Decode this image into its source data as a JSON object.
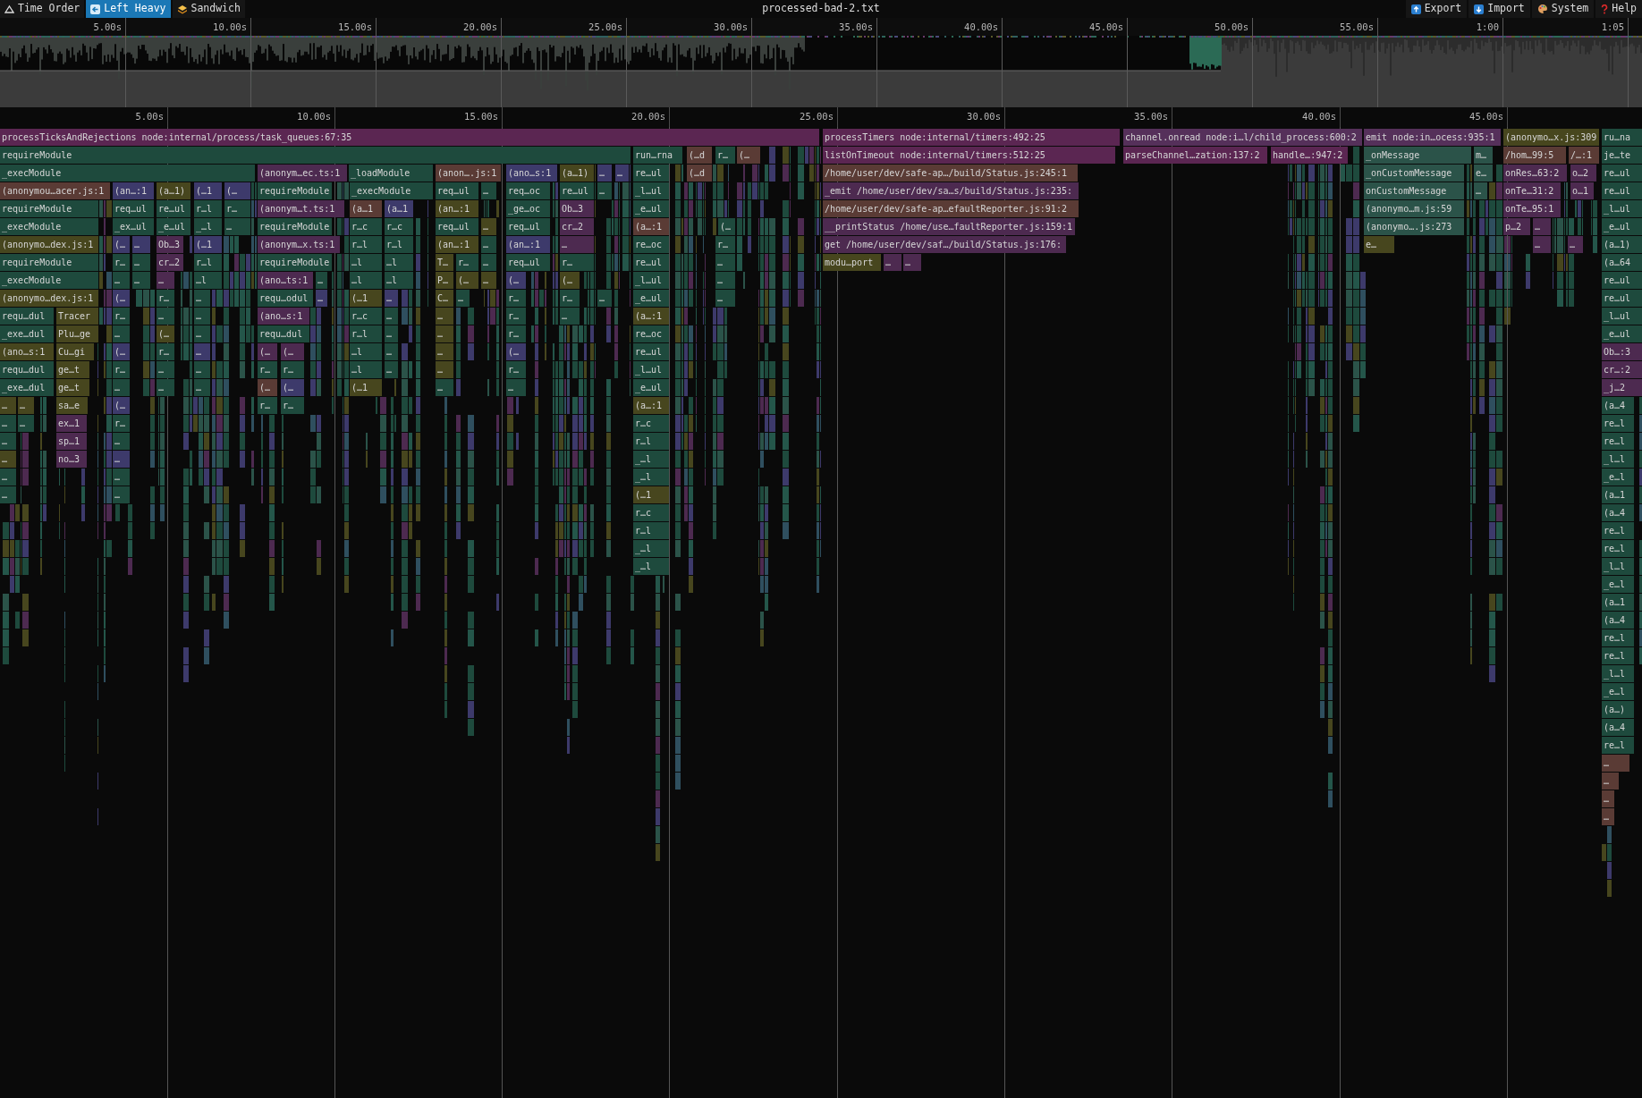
{
  "toolbar": {
    "view_tabs": [
      {
        "label": "Time Order",
        "selected": false,
        "kind": "time"
      },
      {
        "label": "Left Heavy",
        "selected": true,
        "kind": "left"
      },
      {
        "label": "Sandwich",
        "selected": false,
        "kind": "sandwich"
      }
    ],
    "title": "processed-bad-2.txt",
    "actions": [
      {
        "label": "Export",
        "kind": "export"
      },
      {
        "label": "Import",
        "kind": "import"
      },
      {
        "label": "System",
        "kind": "system"
      },
      {
        "label": "Help",
        "kind": "help"
      }
    ]
  },
  "overview": {
    "ticks": [
      "5.00s",
      "10.00s",
      "15.00s",
      "20.00s",
      "25.00s",
      "30.00s",
      "35.00s",
      "40.00s",
      "45.00s",
      "50.00s",
      "55.00s",
      "1:00",
      "1:05"
    ]
  },
  "ruler": {
    "ticks": [
      "5.00s",
      "10.00s",
      "15.00s",
      "20.00s",
      "25.00s",
      "30.00s",
      "35.00s",
      "40.00s",
      "45.00s"
    ]
  },
  "flame_rows": [
    [
      {
        "label": "processTicksAndRejections node:internal/process/task_queues:67:35",
        "color": "#5b2652"
      },
      {
        "label": "processTimers node:internal/timers:492:25",
        "color": "#5b2652"
      },
      {
        "label": "channel.onread node:i…l/child_process:600:2",
        "color": "#55305a"
      },
      {
        "label": "emit node:in…ocess:935:1",
        "color": "#55305a"
      },
      {
        "label": "(anonymo…x.js:309",
        "color": "#47461e"
      },
      {
        "label": "ru…na",
        "color": "#1e4a3d"
      }
    ],
    [
      {
        "label": "requireModule",
        "color": "#1e4a3d"
      },
      {
        "label": "run…rna",
        "color": "#1e4a3d"
      },
      {
        "label": "(…d",
        "color": "#5a3b35"
      },
      {
        "label": "r…",
        "color": "#1e4a3d"
      },
      {
        "label": "(…",
        "color": "#5a3b35"
      },
      {
        "label": "listOnTimeout node:internal/timers:512:25",
        "color": "#5b2652"
      },
      {
        "label": "parseChannel…zation:137:2",
        "color": "#5b2652"
      },
      {
        "label": "handle…:947:2",
        "color": "#5b2652"
      },
      {
        "label": "_onMessage",
        "color": "#2b5349"
      },
      {
        "label": "m…",
        "color": "#2b5349"
      },
      {
        "label": "/hom…99:5",
        "color": "#5a3b35"
      },
      {
        "label": "/…:1",
        "color": "#5a3b35"
      },
      {
        "label": "je…te",
        "color": "#1e4a3d"
      }
    ],
    [
      {
        "label": "_execModule",
        "color": "#1e4a3d"
      },
      {
        "label": "(anonym…ec.ts:1",
        "color": "#4d2a50"
      },
      {
        "label": "_loadModule",
        "color": "#1e4a3d"
      },
      {
        "label": "(anon….js:1",
        "color": "#5a3b35"
      },
      {
        "label": "(ano…s:1",
        "color": "#3d3a6b"
      },
      {
        "label": "(a…1)",
        "color": "#47461e"
      },
      {
        "label": "…",
        "color": "#3d3a6b"
      },
      {
        "label": "…",
        "color": "#3d3a6b"
      },
      {
        "label": "re…ul",
        "color": "#1e4a3d"
      },
      {
        "label": "(…d",
        "color": "#5a3b35"
      },
      {
        "label": "/home/user/dev/safe-ap…/build/Status.js:245:1",
        "color": "#5a3b35"
      },
      {
        "label": "_onCustomMessage",
        "color": "#2b5349"
      },
      {
        "label": "e…",
        "color": "#2b5349"
      },
      {
        "label": "onRes…63:2",
        "color": "#4d2a50"
      },
      {
        "label": "o…2",
        "color": "#4d2a50"
      },
      {
        "label": "re…ul",
        "color": "#1e4a3d"
      }
    ],
    [
      {
        "label": "(anonymou…acer.js:1",
        "color": "#5a3b35"
      },
      {
        "label": "(an…:1",
        "color": "#3d3a6b"
      },
      {
        "label": "(a…1)",
        "color": "#47461e"
      },
      {
        "label": "(…1",
        "color": "#3d3a6b"
      },
      {
        "label": "(…",
        "color": "#3d3a6b"
      },
      {
        "label": "requireModule",
        "color": "#1e4a3d"
      },
      {
        "label": "_execModule",
        "color": "#1e4a3d"
      },
      {
        "label": "req…ul",
        "color": "#1e4a3d"
      },
      {
        "label": "…",
        "color": "#1e4a3d"
      },
      {
        "label": "req…oc",
        "color": "#1e4a3d"
      },
      {
        "label": "re…ul",
        "color": "#1e4a3d"
      },
      {
        "label": "…",
        "color": "#1e4a3d"
      },
      {
        "label": "_l…ul",
        "color": "#1e4a3d"
      },
      {
        "label": "_emit /home/user/dev/sa…s/build/Status.js:235:",
        "color": "#4d2a50"
      },
      {
        "label": "onCustomMessage",
        "color": "#2b5349"
      },
      {
        "label": "…",
        "color": "#2b5349"
      },
      {
        "label": "onTe…31:2",
        "color": "#4d2a50"
      },
      {
        "label": "o…1",
        "color": "#4d2a50"
      },
      {
        "label": "re…ul",
        "color": "#1e4a3d"
      }
    ],
    [
      {
        "label": "requireModule",
        "color": "#1e4a3d"
      },
      {
        "label": "req…ul",
        "color": "#1e4a3d"
      },
      {
        "label": "re…ul",
        "color": "#1e4a3d"
      },
      {
        "label": "r…l",
        "color": "#1e4a3d"
      },
      {
        "label": "r…",
        "color": "#1e4a3d"
      },
      {
        "label": "(anonym…t.ts:1",
        "color": "#4d2a50"
      },
      {
        "label": "(a…1",
        "color": "#5a3b35"
      },
      {
        "label": "(a…1",
        "color": "#3d3a6b"
      },
      {
        "label": "(an…:1",
        "color": "#47461e"
      },
      {
        "label": "_ge…oc",
        "color": "#1e4a3d"
      },
      {
        "label": "Ob…3",
        "color": "#4d2a50"
      },
      {
        "label": "_e…ul",
        "color": "#1e4a3d"
      },
      {
        "label": "/home/user/dev/safe-ap…efaultReporter.js:91:2",
        "color": "#5a3b35"
      },
      {
        "label": "(anonymo…m.js:59",
        "color": "#2b5349"
      },
      {
        "label": "onTe…95:1",
        "color": "#4d2a50"
      },
      {
        "label": "_l…ul",
        "color": "#1e4a3d"
      }
    ],
    [
      {
        "label": "_execModule",
        "color": "#1e4a3d"
      },
      {
        "label": "_ex…ul",
        "color": "#1e4a3d"
      },
      {
        "label": "_e…ul",
        "color": "#1e4a3d"
      },
      {
        "label": "_…l",
        "color": "#1e4a3d"
      },
      {
        "label": "…",
        "color": "#1e4a3d"
      },
      {
        "label": "requireModule",
        "color": "#1e4a3d"
      },
      {
        "label": "r…c",
        "color": "#1e4a3d"
      },
      {
        "label": "r…c",
        "color": "#1e4a3d"
      },
      {
        "label": "req…ul",
        "color": "#1e4a3d"
      },
      {
        "label": "…",
        "color": "#47461e"
      },
      {
        "label": "req…ul",
        "color": "#1e4a3d"
      },
      {
        "label": "cr…2",
        "color": "#4d2a50"
      },
      {
        "label": "(a…:1",
        "color": "#5a3b35"
      },
      {
        "label": "(…",
        "color": "#1e4a3d"
      },
      {
        "label": "__printStatus /home/use…faultReporter.js:159:1",
        "color": "#4d2a50"
      },
      {
        "label": "(anonymo….js:273",
        "color": "#2b5349"
      },
      {
        "label": "p…2",
        "color": "#4d2a50"
      },
      {
        "label": "…",
        "color": "#4d2a50"
      },
      {
        "label": "_e…ul",
        "color": "#1e4a3d"
      }
    ],
    [
      {
        "label": "(anonymo…dex.js:1",
        "color": "#47461e"
      },
      {
        "label": "(…",
        "color": "#3d3a6b"
      },
      {
        "label": "…",
        "color": "#3d3a6b"
      },
      {
        "label": "Ob…3",
        "color": "#4d2a50"
      },
      {
        "label": "(…1",
        "color": "#3d3a6b"
      },
      {
        "label": "(anonym…x.ts:1",
        "color": "#4d2a50"
      },
      {
        "label": "r…l",
        "color": "#1e4a3d"
      },
      {
        "label": "r…l",
        "color": "#1e4a3d"
      },
      {
        "label": "(an…:1",
        "color": "#47461e"
      },
      {
        "label": "…",
        "color": "#1e4a3d"
      },
      {
        "label": "(an…:1",
        "color": "#3d3a6b"
      },
      {
        "label": "…",
        "color": "#4d2a50"
      },
      {
        "label": "re…oc",
        "color": "#1e4a3d"
      },
      {
        "label": "r…",
        "color": "#1e4a3d"
      },
      {
        "label": "get /home/user/dev/saf…/build/Status.js:176:",
        "color": "#4d2a50"
      },
      {
        "label": "e…",
        "color": "#47461e"
      },
      {
        "label": "…",
        "color": "#4d2a50"
      },
      {
        "label": "…",
        "color": "#4d2a50"
      },
      {
        "label": "(a…1)",
        "color": "#1e4a3d"
      }
    ],
    [
      {
        "label": "requireModule",
        "color": "#1e4a3d"
      },
      {
        "label": "r…",
        "color": "#1e4a3d"
      },
      {
        "label": "…",
        "color": "#1e4a3d"
      },
      {
        "label": "cr…2",
        "color": "#4d2a50"
      },
      {
        "label": "r…l",
        "color": "#1e4a3d"
      },
      {
        "label": "requireModule",
        "color": "#1e4a3d"
      },
      {
        "label": "…l",
        "color": "#1e4a3d"
      },
      {
        "label": "…l",
        "color": "#1e4a3d"
      },
      {
        "label": "T…",
        "color": "#47461e"
      },
      {
        "label": "r…",
        "color": "#1e4a3d"
      },
      {
        "label": "…",
        "color": "#1e4a3d"
      },
      {
        "label": "req…ul",
        "color": "#1e4a3d"
      },
      {
        "label": "r…",
        "color": "#1e4a3d"
      },
      {
        "label": "re…ul",
        "color": "#1e4a3d"
      },
      {
        "label": "…",
        "color": "#1e4a3d"
      },
      {
        "label": "modu…port",
        "color": "#47461e"
      },
      {
        "label": "…",
        "color": "#4d2a50"
      },
      {
        "label": "…",
        "color": "#4d2a50"
      },
      {
        "label": "(a…64",
        "color": "#1e4a3d"
      }
    ],
    [
      {
        "label": "_execModule",
        "color": "#1e4a3d"
      },
      {
        "label": "…",
        "color": "#1e4a3d"
      },
      {
        "label": "…",
        "color": "#1e4a3d"
      },
      {
        "label": "…",
        "color": "#4d2a50"
      },
      {
        "label": "…l",
        "color": "#1e4a3d"
      },
      {
        "label": "(ano…ts:1",
        "color": "#4d2a50"
      },
      {
        "label": "…",
        "color": "#1e4a3d"
      },
      {
        "label": "…l",
        "color": "#1e4a3d"
      },
      {
        "label": "…l",
        "color": "#1e4a3d"
      },
      {
        "label": "P…",
        "color": "#47461e"
      },
      {
        "label": "(…",
        "color": "#47461e"
      },
      {
        "label": "…",
        "color": "#47461e"
      },
      {
        "label": "(…",
        "color": "#3d3a6b"
      },
      {
        "label": "(…",
        "color": "#47461e"
      },
      {
        "label": "_l…ul",
        "color": "#1e4a3d"
      },
      {
        "label": "…",
        "color": "#1e4a3d"
      },
      {
        "label": "re…ul",
        "color": "#1e4a3d"
      }
    ],
    [
      {
        "label": "(anonymo…dex.js:1",
        "color": "#47461e"
      },
      {
        "label": "(…",
        "color": "#3d3a6b"
      },
      {
        "label": "r…",
        "color": "#1e4a3d"
      },
      {
        "label": "…",
        "color": "#1e4a3d"
      },
      {
        "label": "requ…odul",
        "color": "#1e4a3d"
      },
      {
        "label": "…",
        "color": "#3d3a6b"
      },
      {
        "label": "(…1",
        "color": "#47461e"
      },
      {
        "label": "…",
        "color": "#3d3a6b"
      },
      {
        "label": "C…",
        "color": "#47461e"
      },
      {
        "label": "…",
        "color": "#1e4a3d"
      },
      {
        "label": "r…",
        "color": "#1e4a3d"
      },
      {
        "label": "r…",
        "color": "#1e4a3d"
      },
      {
        "label": "…",
        "color": "#1e4a3d"
      },
      {
        "label": "_e…ul",
        "color": "#1e4a3d"
      },
      {
        "label": "…",
        "color": "#1e4a3d"
      },
      {
        "label": "re…ul",
        "color": "#1e4a3d"
      }
    ],
    [
      {
        "label": "requ…dul",
        "color": "#1e4a3d"
      },
      {
        "label": "Tracer",
        "color": "#47461e"
      },
      {
        "label": "r…",
        "color": "#1e4a3d"
      },
      {
        "label": "…",
        "color": "#1e4a3d"
      },
      {
        "label": "…",
        "color": "#1e4a3d"
      },
      {
        "label": "(ano…s:1",
        "color": "#4d2a50"
      },
      {
        "label": "r…c",
        "color": "#1e4a3d"
      },
      {
        "label": "…",
        "color": "#1e4a3d"
      },
      {
        "label": "…",
        "color": "#47461e"
      },
      {
        "label": "r…",
        "color": "#1e4a3d"
      },
      {
        "label": "…",
        "color": "#1e4a3d"
      },
      {
        "label": "(a…:1",
        "color": "#47461e"
      },
      {
        "label": "_l…ul",
        "color": "#1e4a3d"
      }
    ],
    [
      {
        "label": "_exe…dul",
        "color": "#1e4a3d"
      },
      {
        "label": "Plu…ge",
        "color": "#47461e"
      },
      {
        "label": "…",
        "color": "#1e4a3d"
      },
      {
        "label": "(…",
        "color": "#47461e"
      },
      {
        "label": "…",
        "color": "#1e4a3d"
      },
      {
        "label": "requ…dul",
        "color": "#1e4a3d"
      },
      {
        "label": "r…l",
        "color": "#1e4a3d"
      },
      {
        "label": "…",
        "color": "#1e4a3d"
      },
      {
        "label": "…",
        "color": "#47461e"
      },
      {
        "label": "r…",
        "color": "#1e4a3d"
      },
      {
        "label": "re…oc",
        "color": "#1e4a3d"
      },
      {
        "label": "_e…ul",
        "color": "#1e4a3d"
      }
    ],
    [
      {
        "label": "(ano…s:1",
        "color": "#47461e"
      },
      {
        "label": "Cu…gi",
        "color": "#47461e"
      },
      {
        "label": "(…",
        "color": "#3d3a6b"
      },
      {
        "label": "r…",
        "color": "#1e4a3d"
      },
      {
        "label": "…",
        "color": "#3d3a6b"
      },
      {
        "label": "(…",
        "color": "#4d2a50"
      },
      {
        "label": "(…",
        "color": "#4d2a50"
      },
      {
        "label": "…l",
        "color": "#1e4a3d"
      },
      {
        "label": "…",
        "color": "#1e4a3d"
      },
      {
        "label": "…",
        "color": "#47461e"
      },
      {
        "label": "(…",
        "color": "#3d3a6b"
      },
      {
        "label": "re…ul",
        "color": "#1e4a3d"
      },
      {
        "label": "Ob…:3",
        "color": "#4d2a50"
      }
    ],
    [
      {
        "label": "requ…dul",
        "color": "#1e4a3d"
      },
      {
        "label": "ge…t",
        "color": "#47461e"
      },
      {
        "label": "r…",
        "color": "#1e4a3d"
      },
      {
        "label": "…",
        "color": "#1e4a3d"
      },
      {
        "label": "…",
        "color": "#1e4a3d"
      },
      {
        "label": "r…",
        "color": "#1e4a3d"
      },
      {
        "label": "r…",
        "color": "#1e4a3d"
      },
      {
        "label": "…l",
        "color": "#1e4a3d"
      },
      {
        "label": "…",
        "color": "#1e4a3d"
      },
      {
        "label": "…",
        "color": "#47461e"
      },
      {
        "label": "r…",
        "color": "#1e4a3d"
      },
      {
        "label": "_l…ul",
        "color": "#1e4a3d"
      },
      {
        "label": "cr…:2",
        "color": "#4d2a50"
      }
    ],
    [
      {
        "label": "_exe…dul",
        "color": "#1e4a3d"
      },
      {
        "label": "ge…t",
        "color": "#47461e"
      },
      {
        "label": "…",
        "color": "#1e4a3d"
      },
      {
        "label": "…",
        "color": "#1e4a3d"
      },
      {
        "label": "…",
        "color": "#1e4a3d"
      },
      {
        "label": "(…",
        "color": "#5a3b35"
      },
      {
        "label": "(…",
        "color": "#3d3a6b"
      },
      {
        "label": "(…1",
        "color": "#47461e"
      },
      {
        "label": "…",
        "color": "#1e4a3d"
      },
      {
        "label": "…",
        "color": "#1e4a3d"
      },
      {
        "label": "_e…ul",
        "color": "#1e4a3d"
      },
      {
        "label": "_j…2",
        "color": "#4d2a50"
      }
    ],
    [
      {
        "label": "…",
        "color": "#47461e"
      },
      {
        "label": "…",
        "color": "#47461e"
      },
      {
        "label": "sa…e",
        "color": "#47461e"
      },
      {
        "label": "(…",
        "color": "#3d3a6b"
      },
      {
        "label": "r…",
        "color": "#1e4a3d"
      },
      {
        "label": "r…",
        "color": "#1e4a3d"
      },
      {
        "label": "(a…:1",
        "color": "#47461e"
      },
      {
        "label": "(a…4",
        "color": "#1e4a3d"
      }
    ],
    [
      {
        "label": "…",
        "color": "#1e4a3d"
      },
      {
        "label": "…",
        "color": "#1e4a3d"
      },
      {
        "label": "ex…1",
        "color": "#4d2a50"
      },
      {
        "label": "r…",
        "color": "#1e4a3d"
      },
      {
        "label": "r…c",
        "color": "#1e4a3d"
      },
      {
        "label": "re…l",
        "color": "#1e4a3d"
      }
    ],
    [
      {
        "label": "…",
        "color": "#1e4a3d"
      },
      {
        "label": "sp…1",
        "color": "#4d2a50"
      },
      {
        "label": "…",
        "color": "#1e4a3d"
      },
      {
        "label": "r…l",
        "color": "#1e4a3d"
      },
      {
        "label": "re…l",
        "color": "#1e4a3d"
      }
    ],
    [
      {
        "label": "…",
        "color": "#47461e"
      },
      {
        "label": "no…3",
        "color": "#4d2a50"
      },
      {
        "label": "…",
        "color": "#3d3a6b"
      },
      {
        "label": "_…l",
        "color": "#1e4a3d"
      },
      {
        "label": "_l…l",
        "color": "#1e4a3d"
      }
    ],
    [
      {
        "label": "…",
        "color": "#1e4a3d"
      },
      {
        "label": "…",
        "color": "#1e4a3d"
      },
      {
        "label": "_…l",
        "color": "#1e4a3d"
      },
      {
        "label": "_e…l",
        "color": "#1e4a3d"
      }
    ],
    [
      {
        "label": "…",
        "color": "#1e4a3d"
      },
      {
        "label": "…",
        "color": "#1e4a3d"
      },
      {
        "label": "(…1",
        "color": "#47461e"
      },
      {
        "label": "(a…1",
        "color": "#1e4a3d"
      }
    ],
    [
      {
        "label": "r…c",
        "color": "#1e4a3d"
      },
      {
        "label": "(a…4",
        "color": "#1e4a3d"
      }
    ],
    [
      {
        "label": "r…l",
        "color": "#1e4a3d"
      },
      {
        "label": "re…l",
        "color": "#1e4a3d"
      }
    ],
    [
      {
        "label": "_…l",
        "color": "#1e4a3d"
      },
      {
        "label": "re…l",
        "color": "#1e4a3d"
      }
    ],
    [
      {
        "label": "_…l",
        "color": "#1e4a3d"
      },
      {
        "label": "_l…l",
        "color": "#1e4a3d"
      }
    ],
    [
      {
        "label": "_e…l",
        "color": "#1e4a3d"
      }
    ],
    [
      {
        "label": "(a…1",
        "color": "#1e4a3d"
      }
    ],
    [
      {
        "label": "(a…4",
        "color": "#1e4a3d"
      }
    ],
    [
      {
        "label": "re…l",
        "color": "#1e4a3d"
      }
    ],
    [
      {
        "label": "re…l",
        "color": "#1e4a3d"
      }
    ],
    [
      {
        "label": "_l…l",
        "color": "#1e4a3d"
      }
    ],
    [
      {
        "label": "_e…l",
        "color": "#1e4a3d"
      }
    ],
    [
      {
        "label": "(a…)",
        "color": "#1e4a3d"
      }
    ],
    [
      {
        "label": "(a…4",
        "color": "#1e4a3d"
      }
    ],
    [
      {
        "label": "re…l",
        "color": "#1e4a3d"
      }
    ],
    [
      {
        "label": "…",
        "color": "#5a3b35"
      }
    ],
    [
      {
        "label": "…",
        "color": "#5a3b35"
      }
    ],
    [
      {
        "label": "…",
        "color": "#5a3b35"
      }
    ],
    [
      {
        "label": "…",
        "color": "#5a3b35"
      }
    ]
  ]
}
